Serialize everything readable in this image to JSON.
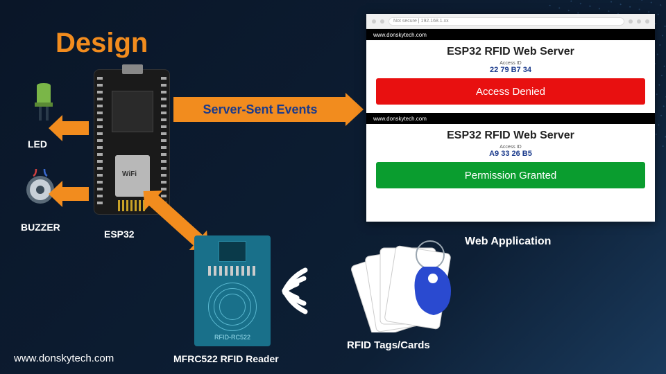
{
  "title": "Design",
  "footer": "www.donskytech.com",
  "components": {
    "led": "LED",
    "buzzer": "BUZZER",
    "esp32": "ESP32",
    "reader": "MFRC522 RFID Reader",
    "reader_board_text": "RFID-RC522",
    "tags": "RFID Tags/Cards",
    "webapp": "Web Application"
  },
  "connection_label": "Server-Sent Events",
  "web": {
    "address_hint": "Not secure | 192.168.1.xx",
    "site": "www.donskytech.com",
    "server_title": "ESP32 RFID Web Server",
    "access_label": "Access ID",
    "denied": {
      "id": "22 79 B7 34",
      "status": "Access Denied"
    },
    "granted": {
      "id": "A9 33 26 B5",
      "status": "Permission Granted"
    }
  }
}
